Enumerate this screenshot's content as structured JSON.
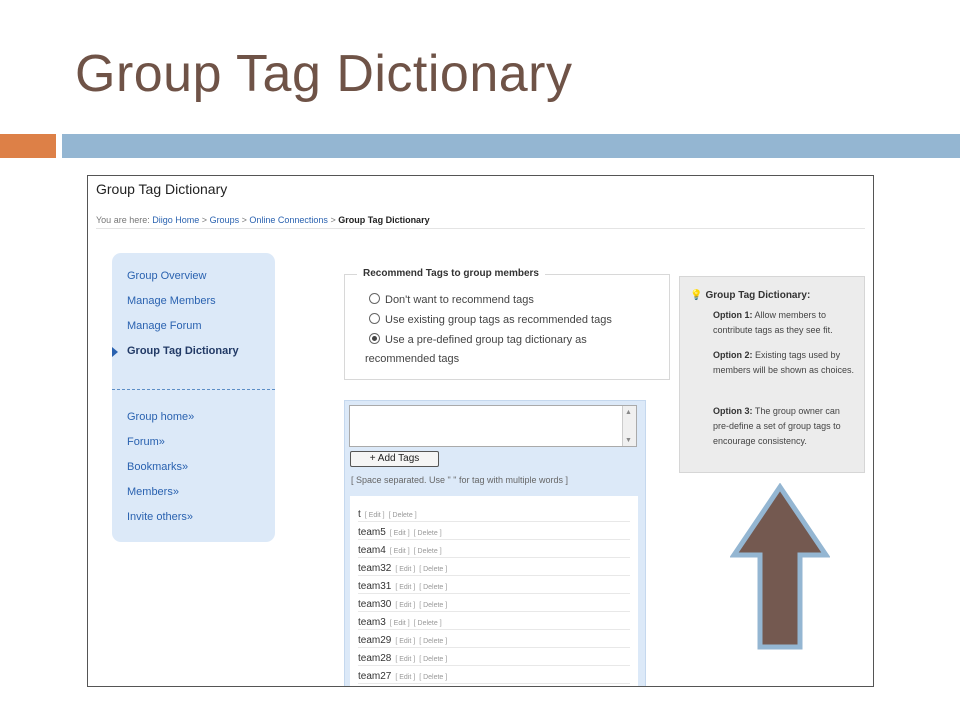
{
  "slide": {
    "title": "Group Tag Dictionary"
  },
  "page": {
    "title": "Group Tag Dictionary",
    "breadcrumb": {
      "prefix": "You are here:",
      "items": [
        "Diigo Home",
        "Groups",
        "Online Connections"
      ],
      "current": "Group Tag Dictionary",
      "separator": ">"
    }
  },
  "sidebar": {
    "items": [
      "Group Overview",
      "Manage Members",
      "Manage Forum",
      "Group Tag Dictionary"
    ],
    "links": [
      "Group home»",
      "Forum»",
      "Bookmarks»",
      "Members»",
      "Invite others»"
    ]
  },
  "recommend": {
    "legend": "Recommend Tags to group members",
    "options": [
      "Don't want to recommend tags",
      "Use existing group tags as recommended tags",
      "Use a pre-defined group tag dictionary as"
    ],
    "option3_cont": "recommended tags",
    "selected_index": 2
  },
  "tags": {
    "add_button": "+ Add Tags",
    "hint": "[ Space separated. Use \" \" for tag with multiple words ]",
    "edit_label": "[ Edit ]",
    "delete_label": "[ Delete ]",
    "list": [
      "t",
      "team5",
      "team4",
      "team32",
      "team31",
      "team30",
      "team3",
      "team29",
      "team28",
      "team27"
    ]
  },
  "info": {
    "title": "Group Tag Dictionary:",
    "options": [
      {
        "label": "Option 1:",
        "text": "Allow members to contribute tags as they see fit."
      },
      {
        "label": "Option 2:",
        "text": "Existing tags used by members will be shown as choices."
      },
      {
        "label": "Option 3:",
        "text": "The group owner can pre-define a set of group tags to encourage consistency."
      }
    ]
  },
  "colors": {
    "title": "#6f5347",
    "accent_orange": "#dd8047",
    "accent_blue": "#94b6d2",
    "arrow_fill": "#745950",
    "arrow_stroke": "#94b6d2",
    "link": "#2a62b0"
  },
  "icons": {
    "info": "lightbulb-icon",
    "arrow": "up-arrow-icon"
  }
}
